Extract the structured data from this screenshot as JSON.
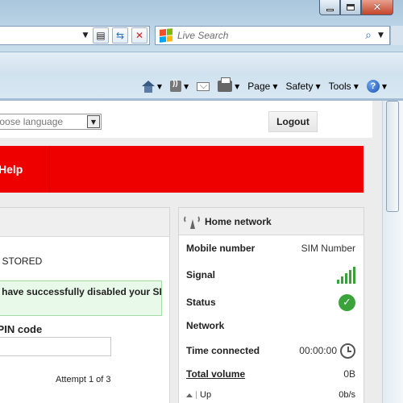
{
  "browser": {
    "search_placeholder": "Live Search",
    "commands": {
      "page": "Page",
      "safety": "Safety",
      "tools": "Tools"
    }
  },
  "page": {
    "language_select": "Choose language",
    "logout_label": "Logout",
    "menu": {
      "help": "Help"
    },
    "left": {
      "status_text": "NOT STORED",
      "success_message": "You have successfully disabled your SIM",
      "pin_label": "Current PIN code",
      "attempt_text": "Attempt 1 of 3"
    },
    "right": {
      "title": "Home network",
      "rows": [
        {
          "label": "Mobile number",
          "value": "SIM Number"
        },
        {
          "label": "Signal",
          "value": ""
        },
        {
          "label": "Status",
          "value": ""
        },
        {
          "label": "Network",
          "value": ""
        },
        {
          "label": "Time connected",
          "value": "00:00:00"
        },
        {
          "label": "Total volume",
          "value": "0B"
        }
      ],
      "up_label": "Up",
      "up_value": "0b/s",
      "signal_level": 5
    }
  },
  "colors": {
    "brand_red": "#ee0000",
    "success_green": "#3aa33a"
  }
}
